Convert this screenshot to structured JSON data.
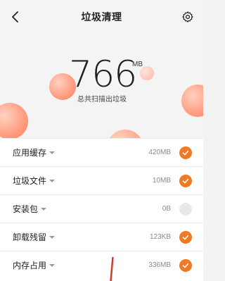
{
  "header": {
    "title": "垃圾清理"
  },
  "summary": {
    "total_value": "766",
    "total_unit": "MB",
    "caption": "总共扫描出垃圾"
  },
  "items": [
    {
      "label": "应用缓存",
      "size": "420MB",
      "checked": true
    },
    {
      "label": "垃圾文件",
      "size": "10MB",
      "checked": true
    },
    {
      "label": "安装包",
      "size": "0B",
      "checked": false
    },
    {
      "label": "卸载残留",
      "size": "123KB",
      "checked": true
    },
    {
      "label": "内存占用",
      "size": "336MB",
      "checked": true
    }
  ],
  "colors": {
    "accent": "#f07a23",
    "bubble": "#ff8b6e"
  },
  "icons": {
    "back": "chevron-left-icon",
    "settings": "gear-icon",
    "checked": "checkmark-icon",
    "dropdown": "caret-down-icon"
  }
}
